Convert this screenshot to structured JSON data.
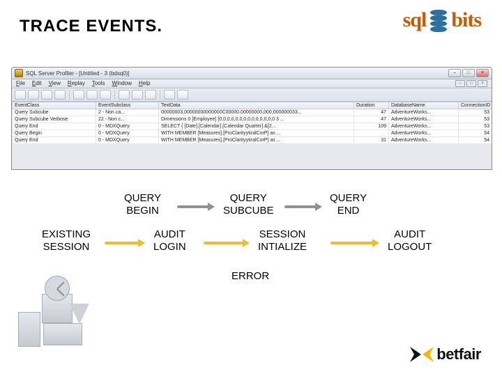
{
  "slide": {
    "title": "TRACE EVENTS."
  },
  "logo_top": {
    "left": "sql",
    "right": "bits"
  },
  "profiler": {
    "window_title": "SQL Server Profiler - [Untitled - 3 (bdsq0)]",
    "menu": [
      "File",
      "Edit",
      "View",
      "Replay",
      "Tools",
      "Window",
      "Help"
    ],
    "win_btn_min": "–",
    "win_btn_max": "□",
    "win_btn_close": "×",
    "columns": [
      "EventClass",
      "EventSubclass",
      "TextData",
      "Duration",
      "DatabaseName",
      "ConnectionID"
    ],
    "rows": [
      {
        "ec": "Query Subcube",
        "es": "2 - Non ca...",
        "td": "00000003,00000000000000C00000,00000000,000,000000033...",
        "du": "47",
        "db": "AdventureWorks...",
        "ci": "53"
      },
      {
        "ec": "Query Subcube Verbose",
        "es": "22 - Non c...",
        "td": "Dimensions 0 [Employee] [0,0,0,0,0,0,0,0,0,0,0,0,0,0 3 ...",
        "du": "47",
        "db": "AdventureWorks...",
        "ci": "53"
      },
      {
        "ec": "Query End",
        "es": "0 - MDXQuery",
        "td": "SELECT { [Date].[Calendar].[Calendar Quarter].&[2...",
        "du": "109",
        "db": "AdventureWorks...",
        "ci": "53"
      },
      {
        "ec": "Query Begin",
        "es": "0 - MDXQuery",
        "td": "WITH MEMBER [Measures].[ProClarityytiralCorP] as ...",
        "du": "",
        "db": "AdventureWorks...",
        "ci": "54"
      },
      {
        "ec": "Query End",
        "es": "0 - MDXQuery",
        "td": "WITH MEMBER [Measures].[ProClarityytiralCorP] as ...",
        "du": "31",
        "db": "AdventureWorks...",
        "ci": "54"
      }
    ]
  },
  "diagram": {
    "query_begin": "QUERY\nBEGIN",
    "query_subcube": "QUERY\nSUBCUBE",
    "query_end": "QUERY\nEND",
    "existing_session": "EXISTING\nSESSION",
    "audit_login": "AUDIT\nLOGIN",
    "session_initialize": "SESSION\nINTIALIZE",
    "audit_logout": "AUDIT\nLOGOUT",
    "error": "ERROR"
  },
  "logo_bottom": {
    "word": "betfair"
  }
}
